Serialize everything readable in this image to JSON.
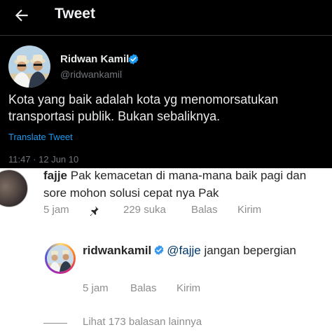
{
  "tweet": {
    "header_title": "Tweet",
    "author_name": "Ridwan Kamil",
    "author_handle": "@ridwankamil",
    "text": "Kota yang baik adalah kota yg menomorsatukan transportasi publik. Bukan sebaliknya.",
    "translate_label": "Translate Tweet",
    "timestamp": "11:47 · 12 Jun 10",
    "colors": {
      "background": "#000000",
      "link": "#1d9bf0",
      "verified": "#1d9bf0"
    },
    "icons": {
      "back": "back-arrow-icon",
      "verified": "verified-badge-icon"
    }
  },
  "comment": {
    "username": "fajje",
    "text": "Pak kemacetan di mana-mana baik pagi dan sore mohon solusi cepat nya Pak",
    "time": "5 jam",
    "likes": "229 suka",
    "reply_label": "Balas",
    "send_label": "Kirim",
    "icons": {
      "pin": "pin-icon"
    }
  },
  "reply": {
    "username": "ridwankamil",
    "mention": "@fajje",
    "text": "jangan bepergian",
    "time": "5 jam",
    "reply_label": "Balas",
    "send_label": "Kirim",
    "icons": {
      "verified": "verified-badge-icon"
    }
  },
  "view_more_replies": "Lihat 173 balasan lainnya"
}
